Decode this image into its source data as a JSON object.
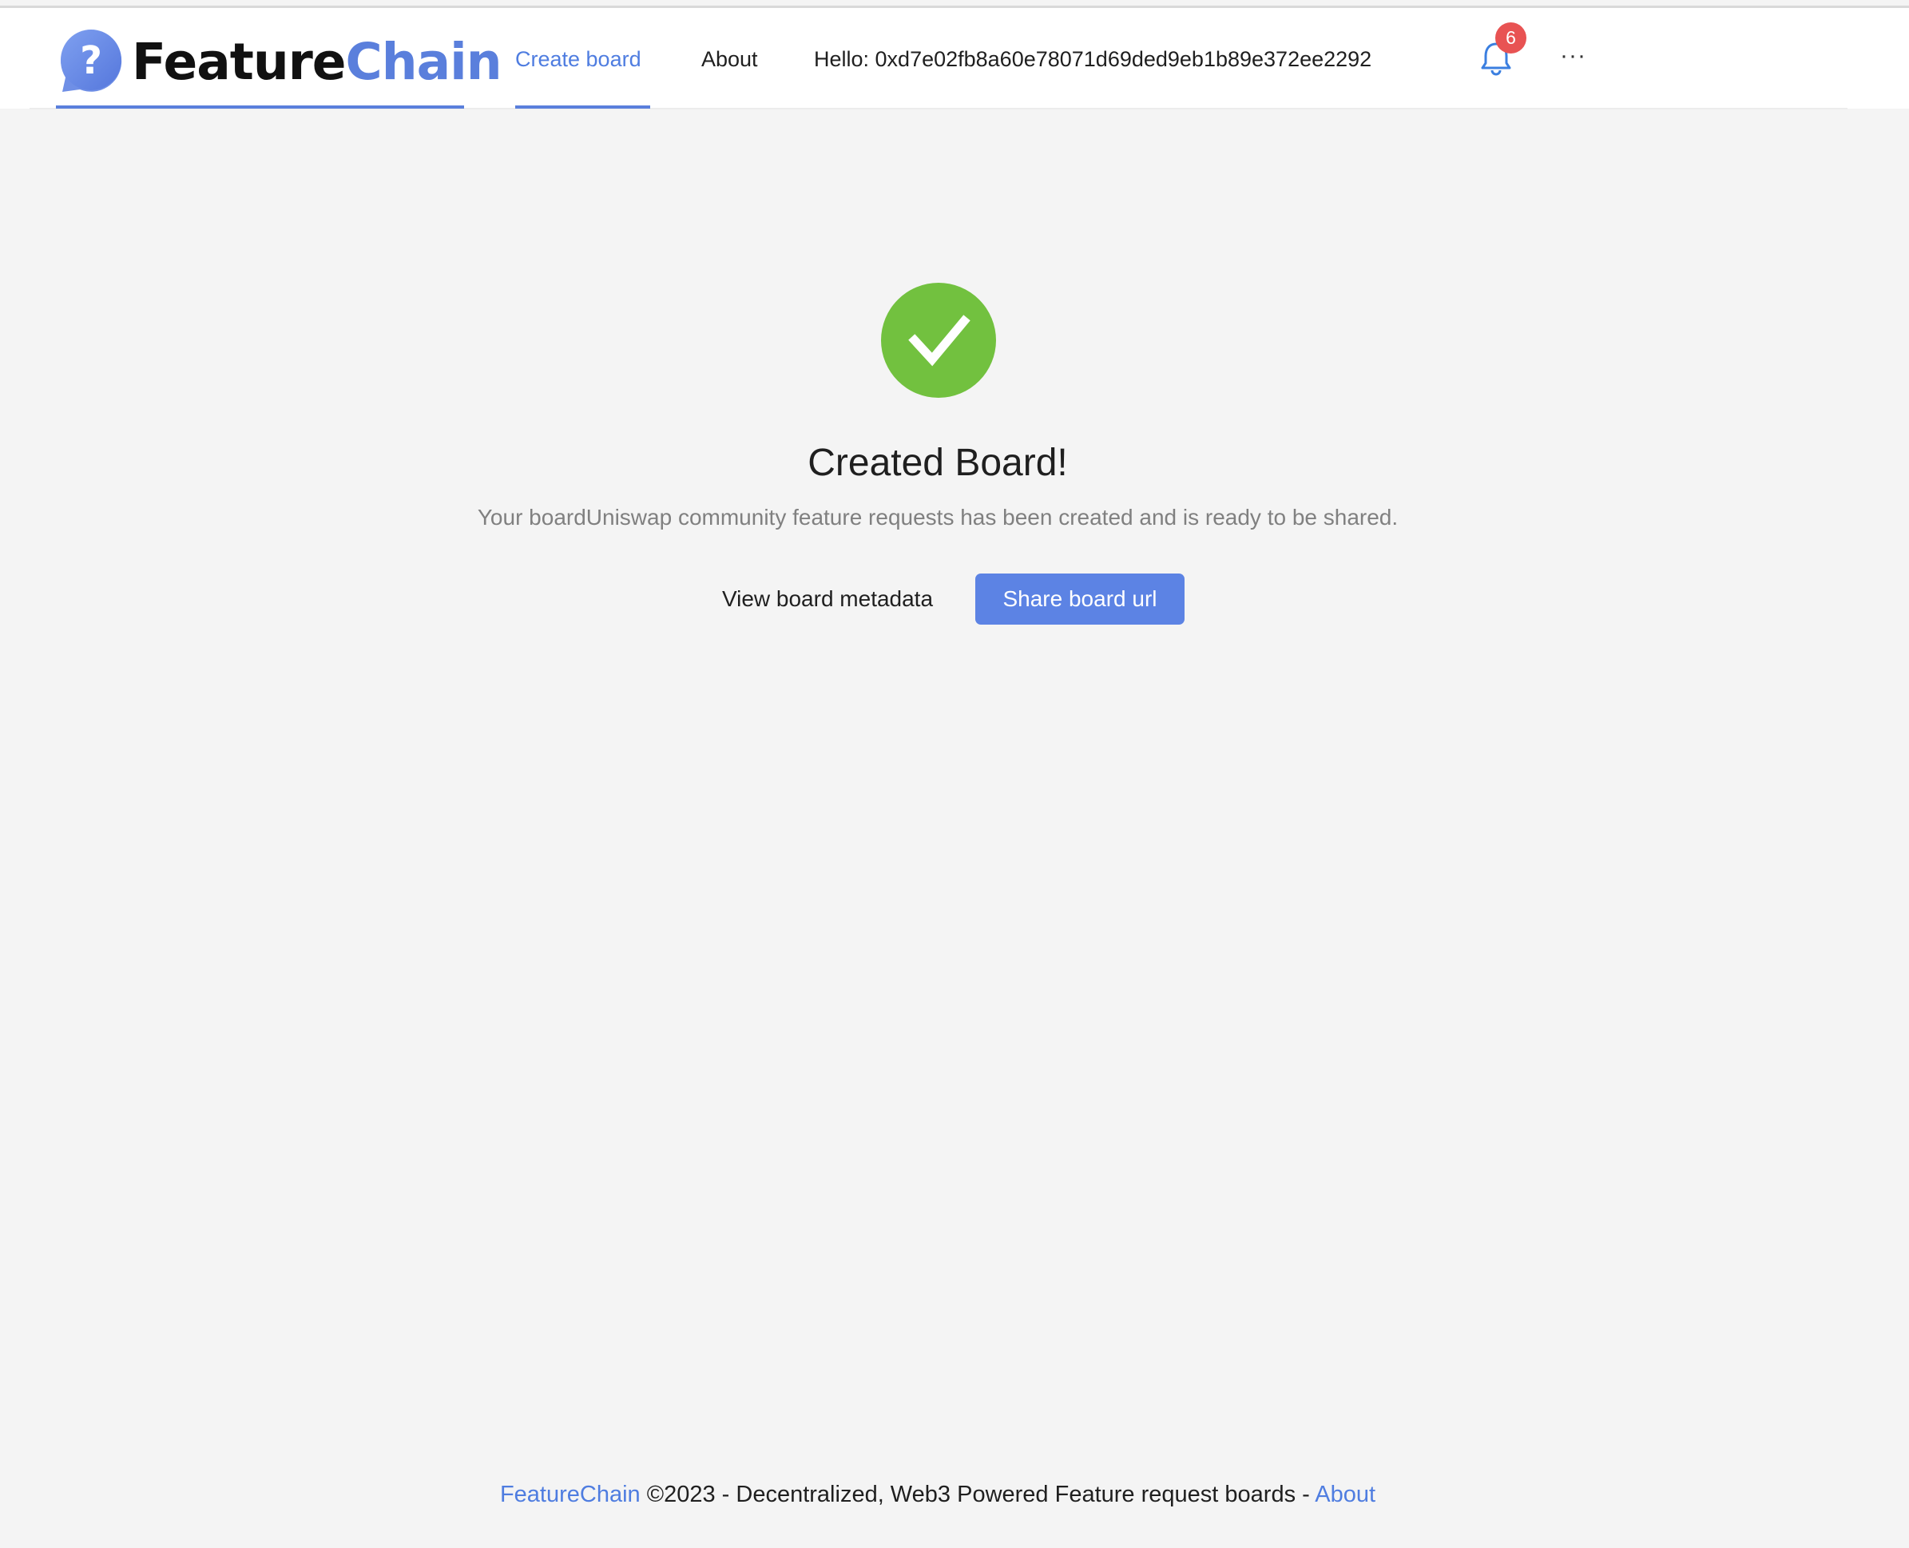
{
  "header": {
    "logo": {
      "brand_part1": "Feature",
      "brand_part2": "Chain",
      "icon": "question-bubble-icon"
    },
    "nav": {
      "create_board": "Create board",
      "about": "About",
      "greeting": "Hello: 0xd7e02fb8a60e78071d69ded9eb1b89e372ee2292"
    },
    "notifications": {
      "icon": "bell-icon",
      "count": "6"
    },
    "more_label": "···"
  },
  "main": {
    "status_icon": "check-circle-icon",
    "title": "Created Board!",
    "subtitle": "Your boardUniswap community feature requests has been created and is ready to be shared.",
    "view_metadata_label": "View board metadata",
    "share_url_label": "Share board url"
  },
  "footer": {
    "brand_link": "FeatureChain",
    "text": " ©2023 - Decentralized, Web3 Powered Feature request boards - ",
    "about_link": "About"
  },
  "colors": {
    "accent": "#5c83e4",
    "success": "#72c13f",
    "badge": "#e85353",
    "background": "#f4f4f4"
  }
}
